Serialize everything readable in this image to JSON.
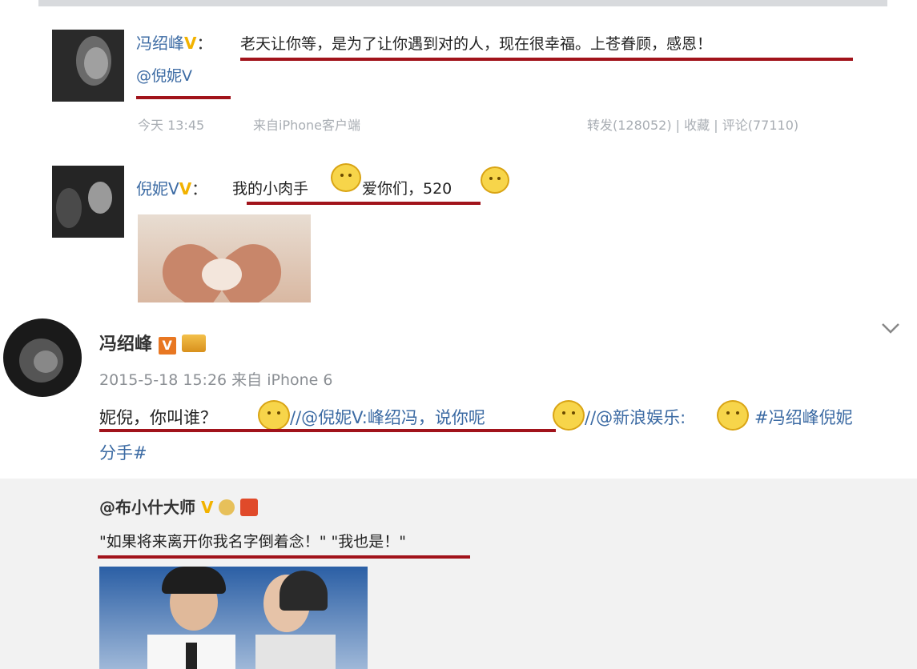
{
  "post1": {
    "author": "冯绍峰",
    "badge": "V",
    "colon": "：",
    "text": "老天让你等，是为了让你遇到对的人，现在很幸福。上苍眷顾，感恩！",
    "mention": "@倪妮V",
    "time": "今天 13:45",
    "source": "来自iPhone客户端",
    "repost": "转发(128052)",
    "sep1": "|",
    "fav": "收藏",
    "sep2": "|",
    "comment": "评论(77110)"
  },
  "reply1": {
    "author": "倪妮V",
    "badge": "V",
    "colon": "：",
    "text_a": "我的小肉手",
    "text_b": "爱你们，520",
    "image_icon": "heart-hands-photo"
  },
  "post2": {
    "author": "冯绍峰",
    "badge_v": "V",
    "timestamp": "2015-5-18 15:26 来自 iPhone 6",
    "line1_a": "妮倪，你叫谁？",
    "line1_b": "//@倪妮V:峰绍冯，说你呢",
    "line1_c": "//@新浪娱乐:",
    "line1_d": "#冯绍峰倪妮",
    "line2": "分手#",
    "menu_icon": "chevron-down-icon"
  },
  "post3": {
    "author": "@布小什大师",
    "badge": "V",
    "text": "\"如果将来离开你我名字倒着念！\" \"我也是！\"",
    "photo_icon": "couple-photo"
  },
  "colors": {
    "underline": "#a1131b",
    "link": "#3b6aa3",
    "meta": "#a8adb3",
    "vip": "#f2b200"
  }
}
